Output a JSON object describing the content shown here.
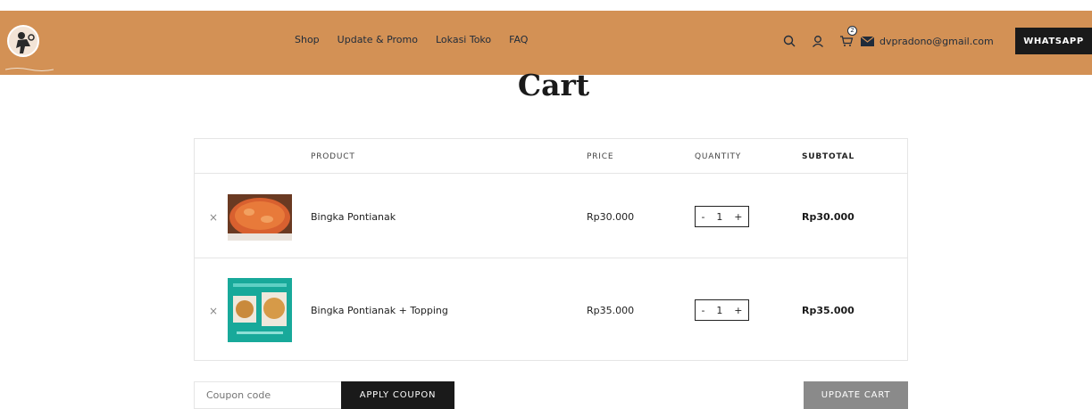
{
  "header": {
    "nav": [
      "Shop",
      "Update & Promo",
      "Lokasi Toko",
      "FAQ"
    ],
    "cart_count": "2",
    "email": "dvpradono@gmail.com",
    "whatsapp_label": "WHATSAPP",
    "icons": [
      "logo-icon",
      "search-icon",
      "user-icon",
      "cart-icon",
      "mail-icon"
    ],
    "colors": {
      "bar": "#d39155",
      "whatsapp": "#1a1a1a"
    }
  },
  "page": {
    "title": "Cart"
  },
  "table": {
    "headers": {
      "product": "PRODUCT",
      "price": "PRICE",
      "quantity": "QUANTITY",
      "subtotal": "SUBTOTAL"
    },
    "rows": [
      {
        "remove": "×",
        "name": "Bingka Pontianak",
        "price": "Rp30.000",
        "qty_minus": "-",
        "qty": "1",
        "qty_plus": "+",
        "subtotal": "Rp30.000"
      },
      {
        "remove": "×",
        "name": "Bingka Pontianak + Topping",
        "price": "Rp35.000",
        "qty_minus": "-",
        "qty": "1",
        "qty_plus": "+",
        "subtotal": "Rp35.000"
      }
    ]
  },
  "actions": {
    "coupon_placeholder": "Coupon code",
    "apply_label": "APPLY COUPON",
    "update_label": "UPDATE CART"
  }
}
